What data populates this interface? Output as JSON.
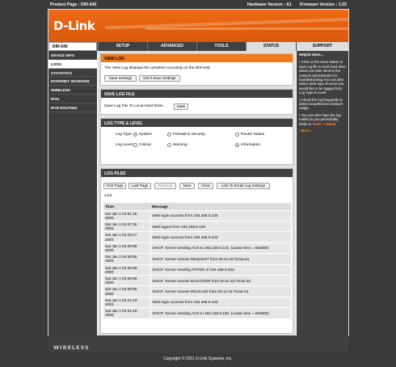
{
  "topbar": {
    "product": "Product Page : DIR-645",
    "hardware": "Hardware Version : A1",
    "firmware": "Firmware Version : 1.02"
  },
  "brand": {
    "logo": "D-Link"
  },
  "model": "DIR-645",
  "tabs": [
    {
      "label": "SETUP",
      "active": false
    },
    {
      "label": "ADVANCED",
      "active": false
    },
    {
      "label": "TOOLS",
      "active": false
    },
    {
      "label": "STATUS",
      "active": true
    }
  ],
  "sidebar": [
    {
      "label": "DEVICE INFO",
      "active": false
    },
    {
      "label": "LOGS",
      "active": true
    },
    {
      "label": "STATISTICS",
      "active": false
    },
    {
      "label": "INTERNET SESSIONS",
      "active": false
    },
    {
      "label": "WIRELESS",
      "active": false
    },
    {
      "label": "IPV6",
      "active": false
    },
    {
      "label": "IPV6 ROUTING",
      "active": false
    }
  ],
  "support": {
    "header": "SUPPORT",
    "title": "Helpful Hints...",
    "hints": [
      "• Click on the Save button to save log file to local hard drive which can later send to the network administrator for troubleshooting.You can also select what type of event you would like to be logged from Log Type & Level.",
      "• Check the log frequently to detect unauthorized network usage.",
      "• You can also have the log mailed to you periodically. Refer to"
    ],
    "tools_link": "Tools -> EMail.",
    "more": "• More..."
  },
  "view_log": {
    "header": "VIEW LOG",
    "description": "The View Log displays the activities occurring on the DIR-645.",
    "save_settings": "Save Settings",
    "dont_save": "Don't Save Settings"
  },
  "save_log_file": {
    "header": "SAVE LOG FILE",
    "label": "Save Log File To Local Hard Drive.",
    "save": "Save"
  },
  "log_type_level": {
    "header": "LOG TYPE & LEVEL",
    "type_label": "Log Type:",
    "types": [
      {
        "label": "System",
        "checked": true
      },
      {
        "label": "Firewall & Security",
        "checked": false
      },
      {
        "label": "Router Status",
        "checked": false
      }
    ],
    "level_label": "Log Level:",
    "levels": [
      {
        "label": "Critical",
        "checked": false
      },
      {
        "label": "Warning",
        "checked": false
      },
      {
        "label": "Information",
        "checked": true
      }
    ]
  },
  "log_files": {
    "header": "LOG FILES",
    "buttons": {
      "first": "First Page",
      "last": "Last Page",
      "previous": "Previous",
      "next": "Next",
      "clear": "Clear",
      "email": "Link To Email Log Settings"
    },
    "page": "1/13",
    "columns": {
      "time": "Time",
      "message": "Message"
    },
    "rows": [
      {
        "time1": "Sat Jan 1 04:51:30",
        "time2": "2000",
        "message": "Web login success from 192.168.0.100"
      },
      {
        "time1": "Sat Jan 1 04:47:46",
        "time2": "2000",
        "message": "Web logout from 192.168.0.100"
      },
      {
        "time1": "Sat Jan 1 04:40:17",
        "time2": "2000",
        "message": "Web login success from 192.168.0.102"
      },
      {
        "time1": "Sat Jan 1 04:39:58",
        "time2": "2000",
        "message": "DHCP: Server sending ACK to 192.168.0.102. (Lease time = 604800)"
      },
      {
        "time1": "Sat Jan 1 04:39:58",
        "time2": "2000",
        "message": "DHCP: Server receive REQUEST from 00:1c:42:76:5a:43."
      },
      {
        "time1": "Sat Jan 1 04:39:58",
        "time2": "2000",
        "message": "DHCP: Server sending OFFER of 192.168.0.102."
      },
      {
        "time1": "Sat Jan 1 04:39:58",
        "time2": "2000",
        "message": "DHCP: Server receive DISCOVER from 00:1c:42:76:5a:43."
      },
      {
        "time1": "Sat Jan 1 04:39:58",
        "time2": "2000",
        "message": "DHCP: Server receive RELEASE from 00:1c:42:76:5a:43."
      },
      {
        "time1": "Sat Jan 1 04:31:53",
        "time2": "2000",
        "message": "Web login success from 192.168.0.100"
      },
      {
        "time1": "Sat Jan 1 04:31:49",
        "time2": "2000",
        "message": "DHCP: Server sending ACK to 192.168.0.100. (Lease time = 604800)"
      }
    ]
  },
  "footer": {
    "wireless": "WIRELESS",
    "copyright": "Copyright © 2011 D-Link Systems, Inc."
  },
  "colors": {
    "orange": "#f27b1c",
    "dark": "#404040"
  }
}
